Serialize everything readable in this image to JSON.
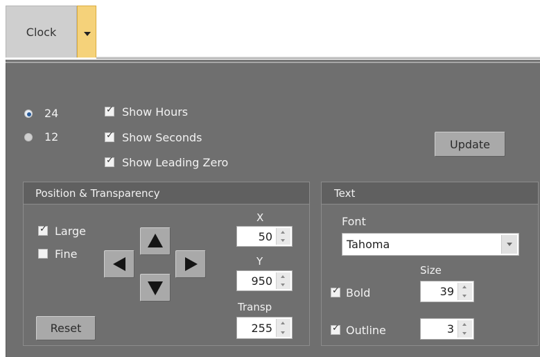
{
  "tab": {
    "label": "Clock"
  },
  "format": {
    "options": [
      {
        "label": "24",
        "selected": true
      },
      {
        "label": "12",
        "selected": false
      }
    ]
  },
  "display_options": [
    {
      "label": "Show Hours",
      "checked": true
    },
    {
      "label": "Show Seconds",
      "checked": true
    },
    {
      "label": "Show Leading Zero",
      "checked": true
    }
  ],
  "update_button": {
    "label": "Update"
  },
  "position_group": {
    "title": "Position & Transparency",
    "large": {
      "label": "Large",
      "checked": true
    },
    "fine": {
      "label": "Fine",
      "checked": false
    },
    "reset_label": "Reset",
    "x": {
      "label": "X",
      "value": "50"
    },
    "y": {
      "label": "Y",
      "value": "950"
    },
    "transp": {
      "label": "Transp",
      "value": "255"
    }
  },
  "text_group": {
    "title": "Text",
    "font_label": "Font",
    "font_value": "Tahoma",
    "size_label": "Size",
    "bold": {
      "label": "Bold",
      "checked": true
    },
    "size_value": "39",
    "outline": {
      "label": "Outline",
      "checked": true
    },
    "outline_value": "3"
  }
}
